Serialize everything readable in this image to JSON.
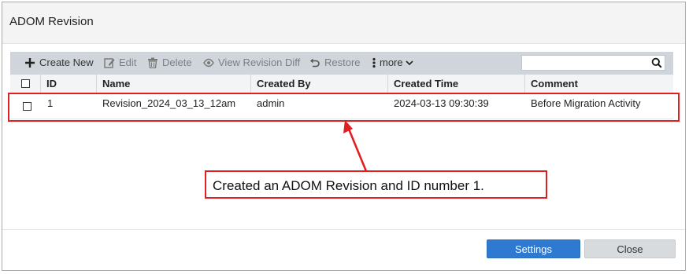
{
  "dialog": {
    "title": "ADOM Revision"
  },
  "toolbar": {
    "create_new": "Create New",
    "edit": "Edit",
    "delete": "Delete",
    "view_revision_diff": "View Revision Diff",
    "restore": "Restore",
    "more": "more",
    "search": {
      "value": "",
      "placeholder": ""
    }
  },
  "table": {
    "headers": [
      "ID",
      "Name",
      "Created By",
      "Created Time",
      "Comment"
    ],
    "rows": [
      {
        "id": "1",
        "name": "Revision_2024_03_13_12am",
        "created_by": "admin",
        "created_time": "2024-03-13 09:30:39",
        "comment": "Before Migration Activity"
      }
    ]
  },
  "annotation": {
    "text": "Created an ADOM Revision and ID number 1.",
    "color": "#e02020"
  },
  "footer": {
    "settings_label": "Settings",
    "close_label": "Close"
  },
  "colors": {
    "accent": "#2f7ad0",
    "toolbar_bg": "#cfd5db",
    "annotation": "#e02020"
  }
}
